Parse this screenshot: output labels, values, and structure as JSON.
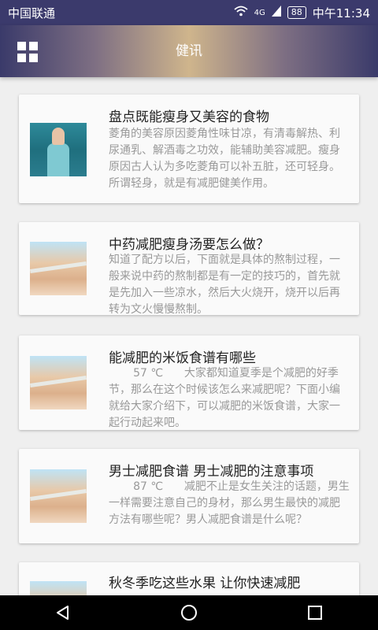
{
  "status_bar": {
    "carrier": "中国联通",
    "network": "4G",
    "battery": "88",
    "time": "中午11:34"
  },
  "app_bar": {
    "title": "健讯",
    "menu_icon": "grid-icon"
  },
  "articles": [
    {
      "title": "盘点既能瘦身又美容的食物",
      "body": "菱角的美容原因菱角性味甘凉，有清毒解热、利尿通乳、解酒毒之功效，能辅助美容减肥。瘦身原因古人认为多吃菱角可以补五脏，还可轻身。所谓轻身，就是有减肥健美作用。"
    },
    {
      "title": "中药减肥瘦身汤要怎么做？",
      "body": "知道了配方以后，下面就是具体的熬制过程，一般来说中药的熬制都是有一定的技巧的，首先就是先加入一些凉水，然后大火烧开，烧开以后再转为文火慢慢熬制。"
    },
    {
      "title": "能减肥的米饭食谱有哪些",
      "body": "       57 ℃      大家都知道夏季是个减肥的好季节，那么在这个时候该怎么来减肥呢？下面小编就给大家介绍下，可以减肥的米饭食谱，大家一起行动起来吧。"
    },
    {
      "title": "男士减肥食谱 男士减肥的注意事项",
      "body": "       87 ℃      减肥不止是女生关注的话题，男生一样需要注意自己的身材，那么男生最快的减肥方法有哪些呢？男人减肥食谱是什么呢？"
    },
    {
      "title": "秋冬季吃这些水果 让你快速减肥",
      "body": ""
    }
  ],
  "nav_bar": {
    "back_icon": "back-triangle-icon",
    "home_icon": "home-circle-icon",
    "recent_icon": "recent-square-icon"
  }
}
